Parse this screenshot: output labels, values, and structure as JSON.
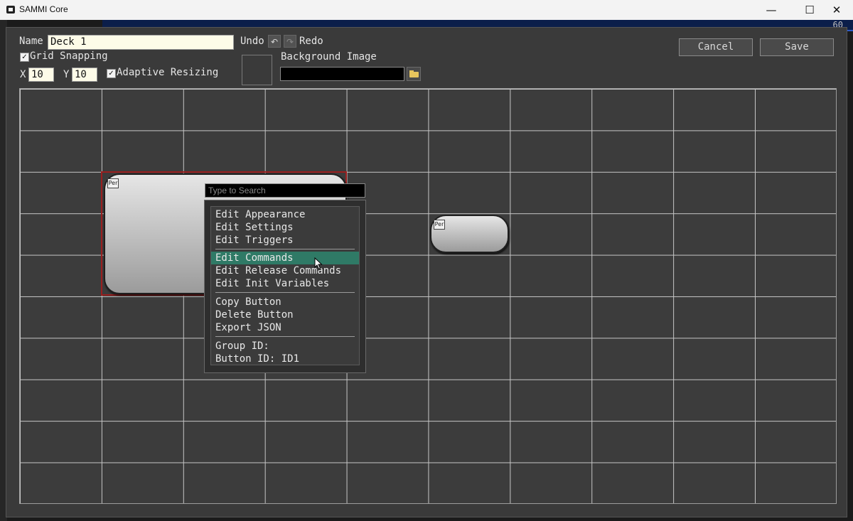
{
  "window": {
    "title": "SAMMI Core",
    "minimize": "—",
    "maximize": "☐",
    "close": "✕"
  },
  "background": {
    "counter": "60"
  },
  "editor": {
    "name_label": "Name",
    "name_value": "Deck 1",
    "undo_label": "Undo",
    "redo_label": "Redo",
    "grid_snapping_label": "Grid Snapping",
    "grid_snapping_checked": true,
    "x_label": "X",
    "x_value": "10",
    "y_label": "Y",
    "y_value": "10",
    "adaptive_resizing_label": "Adaptive Resizing",
    "adaptive_resizing_checked": true,
    "background_image_label": "Background Image",
    "background_image_value": "",
    "cancel_label": "Cancel",
    "save_label": "Save"
  },
  "deck_buttons": [
    {
      "badge": "Per",
      "selected": true
    },
    {
      "badge": "Per",
      "selected": false
    }
  ],
  "context_menu": {
    "search_placeholder": "Type to Search",
    "groups": [
      [
        "Edit Appearance",
        "Edit Settings",
        "Edit Triggers"
      ],
      [
        "Edit Commands",
        "Edit Release Commands",
        "Edit Init Variables"
      ],
      [
        "Copy Button",
        "Delete Button",
        "Export JSON"
      ],
      [
        "Group ID:",
        "Button ID: ID1"
      ]
    ],
    "highlighted": "Edit Commands"
  },
  "icons": {
    "checkbox": "check-icon",
    "undo": "undo-icon",
    "redo": "redo-icon",
    "folder": "folder-icon",
    "cursor": "mouse-pointer-icon"
  },
  "colors": {
    "selection_border": "#9a1f1f",
    "menu_highlight": "#2f7a66",
    "grid_line": "#c6c6c6",
    "panel_bg": "#3a3a3a"
  }
}
